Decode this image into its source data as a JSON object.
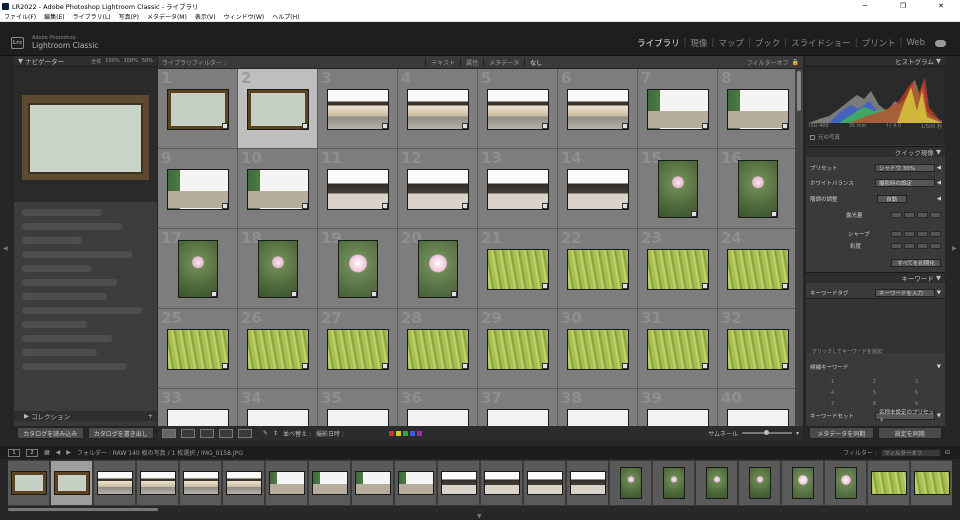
{
  "window": {
    "title": "LR2022 - Adobe Photoshop Lightroom Classic - ライブラリ",
    "minimize": "─",
    "maximize": "❐",
    "close": "✕"
  },
  "menu": [
    "ファイル(F)",
    "編集(E)",
    "ライブラリ(L)",
    "写真(P)",
    "メタデータ(M)",
    "表示(V)",
    "ウィンドウ(W)",
    "ヘルプ(H)"
  ],
  "identity": {
    "logo": "Lrc",
    "line1": "Adobe Photoshop",
    "line2": "Lightroom Classic"
  },
  "modules": [
    {
      "label": "ライブラリ",
      "active": true
    },
    {
      "label": "現像",
      "active": false
    },
    {
      "label": "マップ",
      "active": false
    },
    {
      "label": "ブック",
      "active": false
    },
    {
      "label": "スライドショー",
      "active": false
    },
    {
      "label": "プリント",
      "active": false
    },
    {
      "label": "Web",
      "active": false
    }
  ],
  "navigator": {
    "title": "ナビゲーター",
    "zoom": [
      "全体",
      "100%",
      "100%",
      "50%"
    ]
  },
  "collections": {
    "title": "コレクション"
  },
  "left_buttons": {
    "import": "カタログを読み込み",
    "export": "カタログを書き出し"
  },
  "library_filter": {
    "title": "ライブラリフィルター :",
    "tabs": [
      "テキスト",
      "属性",
      "メタデータ",
      "なし"
    ],
    "selected_tab": "なし",
    "filter_off": "フィルターオフ"
  },
  "grid": {
    "cells": [
      {
        "n": 1,
        "type": "sign",
        "shape": "land"
      },
      {
        "n": 2,
        "type": "sign",
        "shape": "land",
        "selected": true
      },
      {
        "n": 3,
        "type": "bldg",
        "shape": "land"
      },
      {
        "n": 4,
        "type": "bldg",
        "shape": "land"
      },
      {
        "n": 5,
        "type": "bldg",
        "shape": "land"
      },
      {
        "n": 6,
        "type": "bldg",
        "shape": "land"
      },
      {
        "n": 7,
        "type": "tree",
        "shape": "land"
      },
      {
        "n": 8,
        "type": "tree",
        "shape": "land"
      },
      {
        "n": 9,
        "type": "tree",
        "shape": "land"
      },
      {
        "n": 10,
        "type": "tree",
        "shape": "land"
      },
      {
        "n": 11,
        "type": "hall",
        "shape": "land"
      },
      {
        "n": 12,
        "type": "hall",
        "shape": "land"
      },
      {
        "n": 13,
        "type": "hall",
        "shape": "land"
      },
      {
        "n": 14,
        "type": "hall",
        "shape": "land"
      },
      {
        "n": 15,
        "type": "flower",
        "shape": "port"
      },
      {
        "n": 16,
        "type": "flower",
        "shape": "port"
      },
      {
        "n": 17,
        "type": "flower",
        "shape": "port"
      },
      {
        "n": 18,
        "type": "flower",
        "shape": "port"
      },
      {
        "n": 19,
        "type": "flowerbig",
        "shape": "port"
      },
      {
        "n": 20,
        "type": "flowerbig",
        "shape": "port"
      },
      {
        "n": 21,
        "type": "grass",
        "shape": "land"
      },
      {
        "n": 22,
        "type": "grass",
        "shape": "land"
      },
      {
        "n": 23,
        "type": "grass",
        "shape": "land"
      },
      {
        "n": 24,
        "type": "grass",
        "shape": "land"
      },
      {
        "n": 25,
        "type": "grass",
        "shape": "land"
      },
      {
        "n": 26,
        "type": "grass",
        "shape": "land"
      },
      {
        "n": 27,
        "type": "grass",
        "shape": "land"
      },
      {
        "n": 28,
        "type": "grass",
        "shape": "land"
      },
      {
        "n": 29,
        "type": "grass",
        "shape": "land"
      },
      {
        "n": 30,
        "type": "grass",
        "shape": "land"
      },
      {
        "n": 31,
        "type": "grass",
        "shape": "land"
      },
      {
        "n": 32,
        "type": "grass",
        "shape": "land"
      },
      {
        "n": 33,
        "type": "white",
        "shape": "land"
      },
      {
        "n": 34,
        "type": "white",
        "shape": "land"
      },
      {
        "n": 35,
        "type": "white",
        "shape": "land"
      },
      {
        "n": 36,
        "type": "white",
        "shape": "land"
      },
      {
        "n": 37,
        "type": "white",
        "shape": "land"
      },
      {
        "n": 38,
        "type": "white",
        "shape": "land"
      },
      {
        "n": 39,
        "type": "white",
        "shape": "land"
      },
      {
        "n": 40,
        "type": "white",
        "shape": "land"
      }
    ]
  },
  "toolbar": {
    "sort_label": "並べ替え :",
    "sort_value": "撮影日時 :",
    "thumb_label": "サムネール",
    "color_labels": [
      "#c33",
      "#cc3",
      "#3a3",
      "#36c",
      "#939"
    ]
  },
  "histogram": {
    "title": "ヒストグラム",
    "iso": "ISO 400",
    "focal": "35 mm",
    "aperture": "f / 4.0",
    "shutter": "1/500 秒",
    "original": "元の写真"
  },
  "quick_develop": {
    "title": "クイック現像",
    "preset_label": "プリセット",
    "preset_value": "シャドウ 30%",
    "wb_label": "ホワイトバランス",
    "wb_value": "撮影時の設定",
    "tone_label": "階調の調整",
    "auto": "自動",
    "exposure": "露光量",
    "sharpness": "シャープ",
    "saturation": "彩度",
    "reset": "すべてを初期化"
  },
  "keywords": {
    "title": "キーワード",
    "tag_label": "キーワードタグ",
    "tag_value": "キーワードを入力",
    "hint": "クリックしてキーワードを追加",
    "suggest": "候補キーワード",
    "set_label": "キーワードセット",
    "set_value": "名称未設定のプリセット",
    "grid": [
      "1",
      "2",
      "3",
      "4",
      "5",
      "6",
      "7",
      "8",
      "9"
    ]
  },
  "right_buttons": {
    "sync_meta": "メタデータを同期",
    "sync_settings": "設定を同期"
  },
  "filmstrip": {
    "page1": "1",
    "page2": "2",
    "path": "フォルダー : RAW  140 枚の写真 / 1 枚選択 / IMG_0158.JPG",
    "filter_label": "フィルター :",
    "filter_value": "フィルターオフ",
    "items": [
      "sign",
      "sign",
      "bldg",
      "bldg",
      "bldg",
      "bldg",
      "tree",
      "tree",
      "tree",
      "tree",
      "hall",
      "hall",
      "hall",
      "hall",
      "flower",
      "flower",
      "flower",
      "flower",
      "flowerbig",
      "flowerbig",
      "grass",
      "grass"
    ],
    "selected_index": 1
  }
}
